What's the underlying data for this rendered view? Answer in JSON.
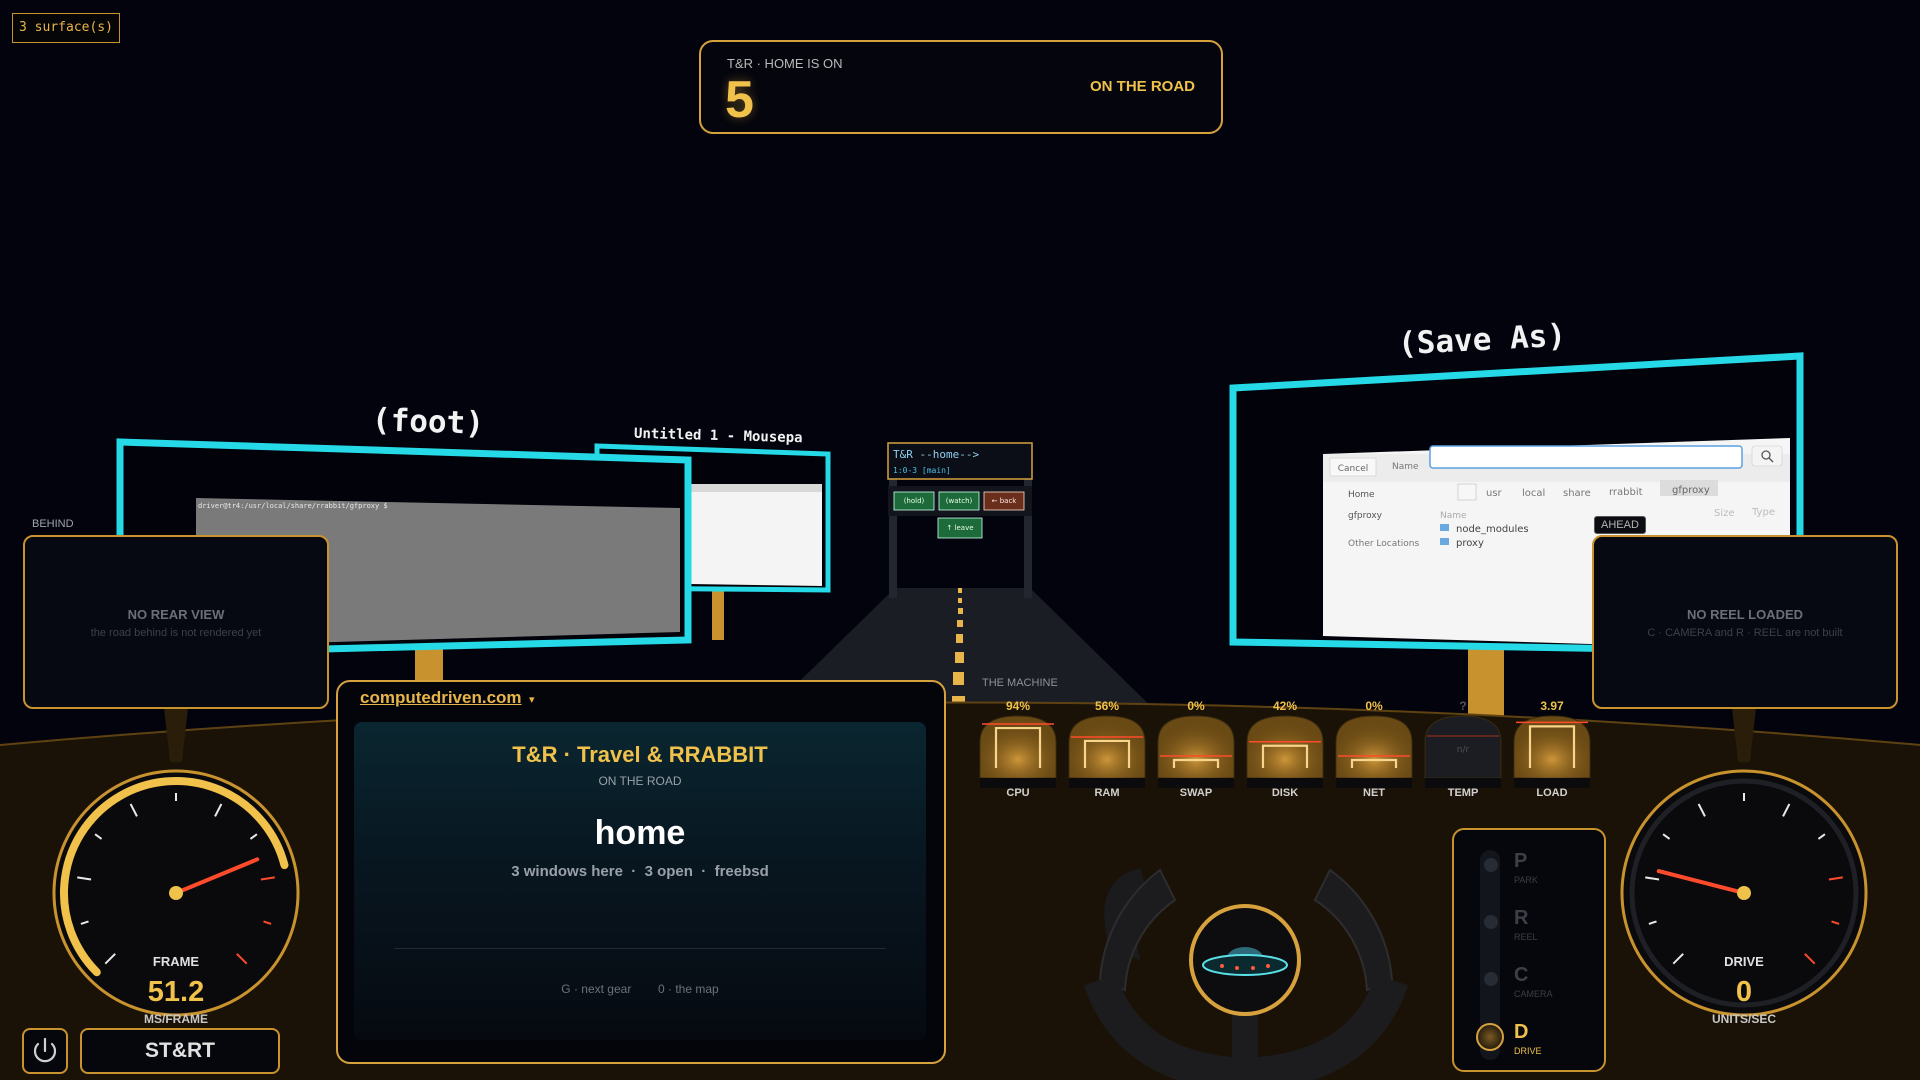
{
  "surface_count": "3 surface(s)",
  "banner": {
    "label": "T&R · HOME IS ON",
    "number": "5",
    "status": "ON THE ROAD"
  },
  "billboards": {
    "foot": {
      "title": "(foot)",
      "terminal_text": "driver@tr4:/usr/local/share/rrabbit/gfproxy $ "
    },
    "mousepad": {
      "title": "Untitled 1 - Mousepa"
    },
    "save_as": {
      "title": "(Save As)",
      "cancel_label": "Cancel",
      "name_label": "Name",
      "path": [
        "usr",
        "local",
        "share",
        "rrabbit",
        "gfproxy"
      ],
      "places": [
        "Home",
        "gfproxy",
        "Other Locations"
      ],
      "columns": [
        "Name",
        "Size",
        "Type"
      ],
      "files": [
        "node_modules",
        "proxy"
      ]
    },
    "sign": {
      "line1": "T&R --home-->",
      "line2": "1:0-3 [main]",
      "tiles": [
        "(hold)",
        "(watch)",
        "← back",
        "↑ leave"
      ]
    }
  },
  "behind": {
    "tag": "BEHIND",
    "title": "NO REAR VIEW",
    "subtitle": "the road behind is not rendered yet"
  },
  "ahead": {
    "tag": "AHEAD",
    "title": "NO REEL LOADED",
    "subtitle": "C · CAMERA and R · REEL are not built"
  },
  "center": {
    "site": "computedriven.com",
    "dropdown_icon": "▾",
    "title": "T&R · Travel & RRABBIT",
    "subtitle": "ON THE ROAD",
    "location": "home",
    "details": "3 windows here  ·  3 open  ·  freebsd",
    "hints": "G · next gear        0 · the map"
  },
  "machine": {
    "title": "THE MACHINE",
    "gauges": [
      {
        "label": "CPU",
        "value": "94%",
        "level": 0.94,
        "status": ""
      },
      {
        "label": "RAM",
        "value": "56%",
        "level": 0.56,
        "status": ""
      },
      {
        "label": "SWAP",
        "value": "0%",
        "level": 0.0,
        "status": ""
      },
      {
        "label": "DISK",
        "value": "42%",
        "level": 0.42,
        "status": ""
      },
      {
        "label": "NET",
        "value": "0%",
        "level": 0.0,
        "status": ""
      },
      {
        "label": "TEMP",
        "value": "?",
        "level": null,
        "status": "n/r"
      },
      {
        "label": "LOAD",
        "value": "3.97",
        "level": 0.99,
        "status": ""
      }
    ]
  },
  "gears": [
    {
      "letter": "P",
      "name": "PARK",
      "active": false
    },
    {
      "letter": "R",
      "name": "REEL",
      "active": false
    },
    {
      "letter": "C",
      "name": "CAMERA",
      "active": false
    },
    {
      "letter": "D",
      "name": "DRIVE",
      "active": true
    }
  ],
  "frame_dial": {
    "label": "FRAME",
    "value": "51.2",
    "unit": "MS/FRAME",
    "needle_fraction": 0.75,
    "arc_fraction": 0.78
  },
  "drive_dial": {
    "label": "DRIVE",
    "value": "0",
    "unit": "UNITS/SEC",
    "needle_fraction": 0.22
  },
  "controls": {
    "start_label": "ST&RT",
    "power_icon": "power-icon"
  },
  "colors": {
    "accent": "#f0c14b",
    "frame_border": "#26d9e6",
    "needle": "#ff4b2b"
  }
}
